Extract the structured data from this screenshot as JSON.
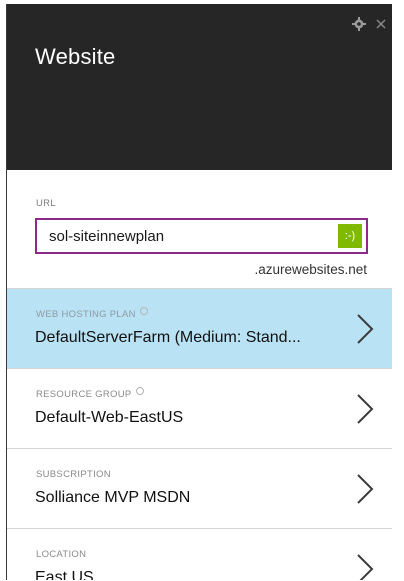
{
  "header": {
    "title": "Website",
    "icons": [
      "gear-icon",
      "close-icon"
    ]
  },
  "url": {
    "label": "URL",
    "value": "sol-siteinnewplan",
    "validation": ":-)",
    "suffix": ".azurewebsites.net"
  },
  "rows": [
    {
      "label": "WEB HOSTING PLAN",
      "value": "DefaultServerFarm (Medium: Stand...",
      "info": true,
      "selected": true
    },
    {
      "label": "RESOURCE GROUP",
      "value": "Default-Web-EastUS",
      "info": true,
      "selected": false
    },
    {
      "label": "SUBSCRIPTION",
      "value": "Solliance MVP MSDN",
      "info": false,
      "selected": false
    },
    {
      "label": "LOCATION",
      "value": "East US",
      "info": false,
      "selected": false
    }
  ],
  "colors": {
    "header_bg": "#262626",
    "accent_border": "#8b2a8a",
    "ok_green": "#7fba00",
    "selected_row": "#b9e2f5"
  }
}
